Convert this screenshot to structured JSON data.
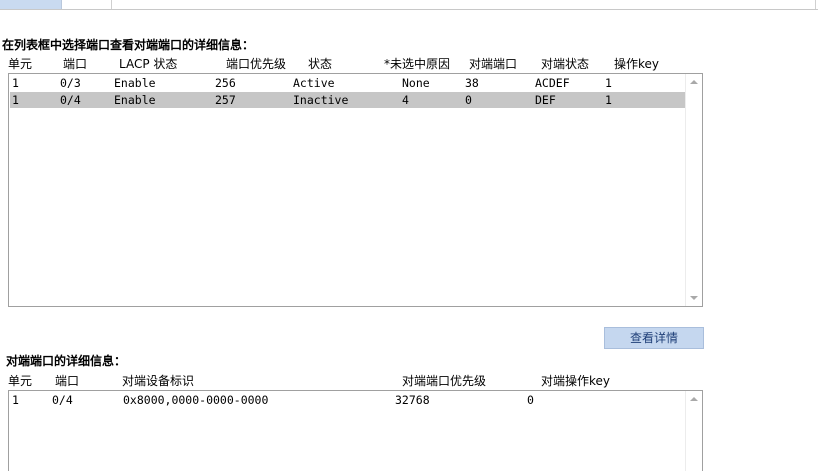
{
  "tabs": [
    {
      "label": ""
    },
    {
      "label": ""
    }
  ],
  "top": {
    "title": "在列表框中选择端口查看对端端口的详细信息：",
    "headers": [
      "单元",
      "端口",
      "LACP 状态",
      "端口优先级",
      "状态",
      "*未选中原因",
      "对端端口",
      "对端状态",
      "操作key"
    ],
    "rows": [
      {
        "unit": "1",
        "port": "0/3",
        "lacp": "Enable",
        "priority": "256",
        "state": "Active",
        "reason": "None",
        "peer_port": "38",
        "peer_state": "ACDEF",
        "key": "1"
      },
      {
        "unit": "1",
        "port": "0/4",
        "lacp": "Enable",
        "priority": "257",
        "state": "Inactive",
        "reason": "4",
        "peer_port": "0",
        "peer_state": "DEF",
        "key": "1"
      }
    ],
    "selected_row_index": 1
  },
  "view_details_button": "查看详情",
  "bottom": {
    "title": "对端端口的详细信息：",
    "headers": [
      "单元",
      "端口",
      "对端设备标识",
      "对端端口优先级",
      "对端操作key"
    ],
    "rows": [
      {
        "unit": "1",
        "port": "0/4",
        "device_id": "0x8000,0000-0000-0000",
        "peer_priority": "32768",
        "peer_key": "0"
      }
    ]
  },
  "colors": {
    "selected_row": "#c6c6c6",
    "button_bg": "#c5d7ef",
    "tab_active": "#c9daf0"
  }
}
